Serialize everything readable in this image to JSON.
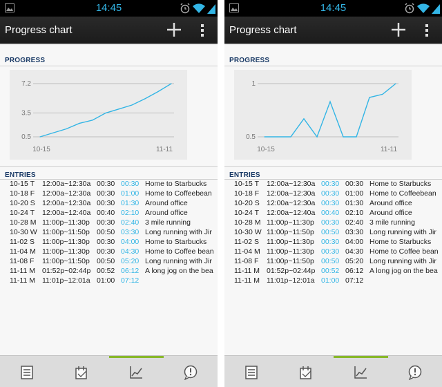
{
  "status": {
    "time": "14:45"
  },
  "app": {
    "title": "Progress chart"
  },
  "sections": {
    "progress": "PROGRESS",
    "entries": "ENTRIES"
  },
  "colors": {
    "accent": "#33b5e5",
    "tab_indicator": "#88b82a",
    "header_text": "#1a3a66"
  },
  "tabs": [
    {
      "icon": "list-icon",
      "selected": false
    },
    {
      "icon": "calendar-icon",
      "selected": false
    },
    {
      "icon": "chart-icon",
      "selected": true
    },
    {
      "icon": "feedback-icon",
      "selected": false
    }
  ],
  "screens": [
    {
      "blue_column": 2,
      "chart_data": {
        "type": "line",
        "x_tick_labels": [
          "10-15",
          "11-11"
        ],
        "y_tick_labels": [
          "7.2",
          "3.5",
          "0.5"
        ],
        "ylim": [
          0.5,
          7.2
        ],
        "grid": true,
        "x": [
          "10-15",
          "10-18",
          "10-20",
          "10-24",
          "10-28",
          "10-30",
          "11-02",
          "11-04",
          "11-08",
          "11-11",
          "11-11"
        ],
        "values": [
          0.5,
          1.0,
          1.5,
          2.2,
          2.6,
          3.5,
          4.0,
          4.5,
          5.3,
          6.2,
          7.2
        ]
      },
      "entries": [
        {
          "date": "10-15 T",
          "range": "12:00a~12:30a",
          "d1": "00:30",
          "d2": "00:30",
          "name": "Home to Starbucks"
        },
        {
          "date": "10-18 F",
          "range": "12:00a~12:30a",
          "d1": "00:30",
          "d2": "01:00",
          "name": "Home to Coffeebean"
        },
        {
          "date": "10-20 S",
          "range": "12:00a~12:30a",
          "d1": "00:30",
          "d2": "01:30",
          "name": "Around office"
        },
        {
          "date": "10-24 T",
          "range": "12:00a~12:40a",
          "d1": "00:40",
          "d2": "02:10",
          "name": "Around office"
        },
        {
          "date": "10-28 M",
          "range": "11:00p~11:30p",
          "d1": "00:30",
          "d2": "02:40",
          "name": "3 mile running"
        },
        {
          "date": "10-30 W",
          "range": "11:00p~11:50p",
          "d1": "00:50",
          "d2": "03:30",
          "name": "Long running with Jir"
        },
        {
          "date": "11-02 S",
          "range": "11:00p~11:30p",
          "d1": "00:30",
          "d2": "04:00",
          "name": "Home to Starbucks"
        },
        {
          "date": "11-04 M",
          "range": "11:00p~11:30p",
          "d1": "00:30",
          "d2": "04:30",
          "name": "Home to Coffee bean"
        },
        {
          "date": "11-08 F",
          "range": "11:00p~11:50p",
          "d1": "00:50",
          "d2": "05:20",
          "name": "Long running with Jir"
        },
        {
          "date": "11-11 M",
          "range": "01:52p~02:44p",
          "d1": "00:52",
          "d2": "06:12",
          "name": "A long jog on the bea"
        },
        {
          "date": "11-11 M",
          "range": "11:01p~12:01a",
          "d1": "01:00",
          "d2": "07:12",
          "name": ""
        }
      ]
    },
    {
      "blue_column": 1,
      "chart_data": {
        "type": "line",
        "x_tick_labels": [
          "10-15",
          "11-11"
        ],
        "y_tick_labels": [
          "1",
          "0.5"
        ],
        "ylim": [
          0.5,
          1.0
        ],
        "grid": true,
        "x": [
          "10-15",
          "10-18",
          "10-20",
          "10-24",
          "10-28",
          "10-30",
          "11-02",
          "11-04",
          "11-08",
          "11-11",
          "11-11"
        ],
        "values": [
          0.5,
          0.5,
          0.5,
          0.67,
          0.5,
          0.83,
          0.5,
          0.5,
          0.87,
          0.9,
          1.0
        ]
      },
      "entries": [
        {
          "date": "10-15 T",
          "range": "12:00a~12:30a",
          "d1": "00:30",
          "d2": "00:30",
          "name": "Home to Starbucks"
        },
        {
          "date": "10-18 F",
          "range": "12:00a~12:30a",
          "d1": "00:30",
          "d2": "01:00",
          "name": "Home to Coffeebean"
        },
        {
          "date": "10-20 S",
          "range": "12:00a~12:30a",
          "d1": "00:30",
          "d2": "01:30",
          "name": "Around office"
        },
        {
          "date": "10-24 T",
          "range": "12:00a~12:40a",
          "d1": "00:40",
          "d2": "02:10",
          "name": "Around office"
        },
        {
          "date": "10-28 M",
          "range": "11:00p~11:30p",
          "d1": "00:30",
          "d2": "02:40",
          "name": "3 mile running"
        },
        {
          "date": "10-30 W",
          "range": "11:00p~11:50p",
          "d1": "00:50",
          "d2": "03:30",
          "name": "Long running with Jir"
        },
        {
          "date": "11-02 S",
          "range": "11:00p~11:30p",
          "d1": "00:30",
          "d2": "04:00",
          "name": "Home to Starbucks"
        },
        {
          "date": "11-04 M",
          "range": "11:00p~11:30p",
          "d1": "00:30",
          "d2": "04:30",
          "name": "Home to Coffee bean"
        },
        {
          "date": "11-08 F",
          "range": "11:00p~11:50p",
          "d1": "00:50",
          "d2": "05:20",
          "name": "Long running with Jir"
        },
        {
          "date": "11-11 M",
          "range": "01:52p~02:44p",
          "d1": "00:52",
          "d2": "06:12",
          "name": "A long jog on the bea"
        },
        {
          "date": "11-11 M",
          "range": "11:01p~12:01a",
          "d1": "01:00",
          "d2": "07:12",
          "name": ""
        }
      ]
    }
  ]
}
